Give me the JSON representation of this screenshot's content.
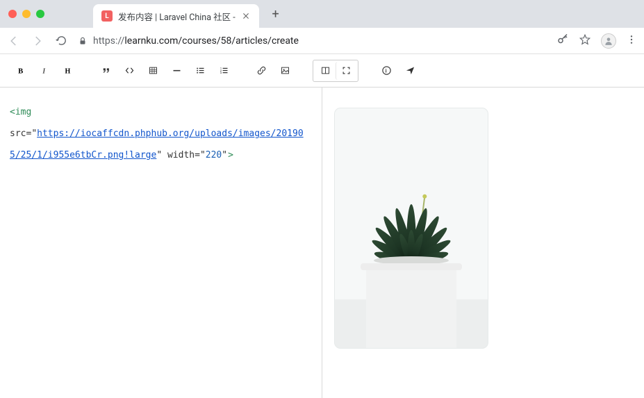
{
  "browser": {
    "tab_title": "发布内容 | Laravel China 社区 - ",
    "url_protocol": "https://",
    "url_rest": "learnku.com/courses/58/articles/create"
  },
  "editor": {
    "code": {
      "tag_open": "<img",
      "attr_src_name": "src",
      "attr_src_value": "https://iocaffcdn.phphub.org/uploads/images/201905/25/1/i955e6tbCr.png!large",
      "attr_width_name": "width",
      "attr_width_value": "220",
      "tag_close": ">"
    },
    "preview_image_width": 220
  },
  "toolbar": {
    "icons": [
      "bold",
      "italic",
      "heading",
      "quote",
      "code",
      "table",
      "hr",
      "ul",
      "ol",
      "link",
      "image",
      "split-view",
      "fullscreen",
      "help",
      "submit"
    ]
  }
}
